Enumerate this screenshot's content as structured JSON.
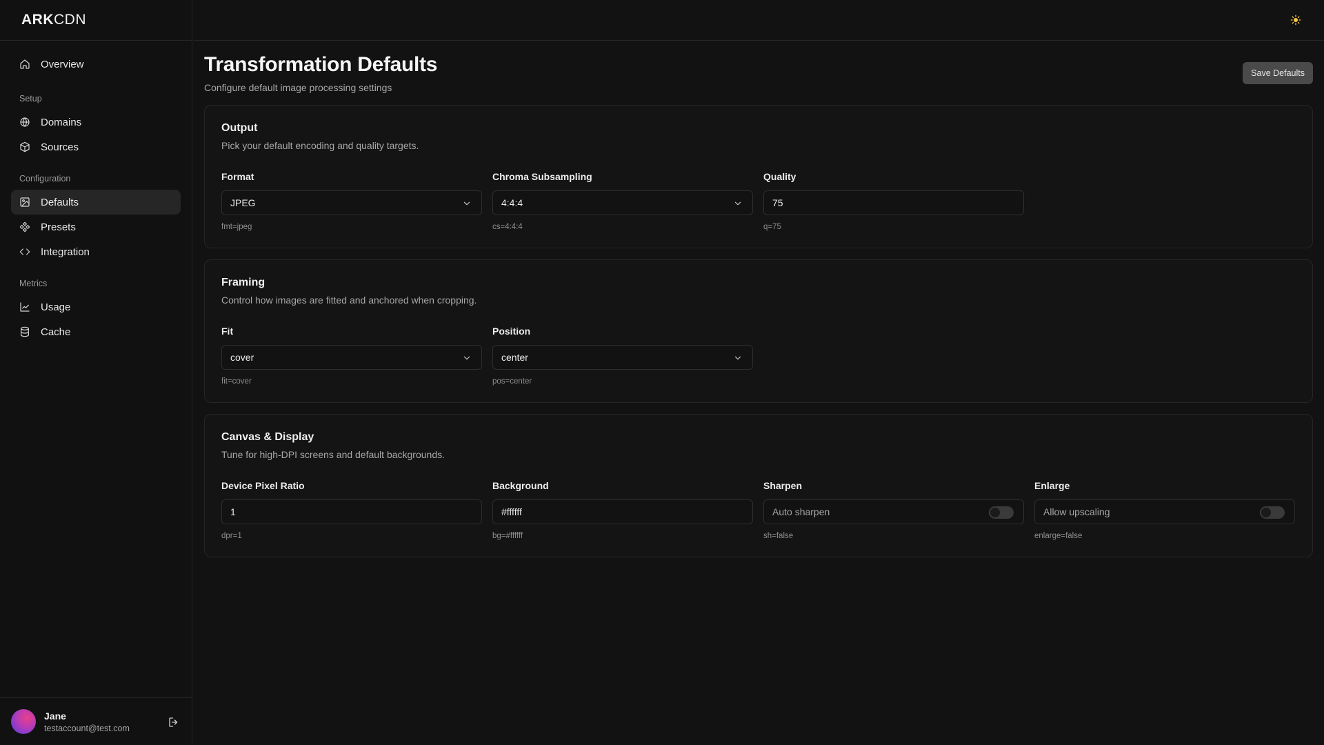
{
  "brand": {
    "strong": "ARK",
    "light": "CDN"
  },
  "nav": {
    "overview": "Overview",
    "setup_section": "Setup",
    "domains": "Domains",
    "sources": "Sources",
    "configuration_section": "Configuration",
    "defaults": "Defaults",
    "presets": "Presets",
    "integration": "Integration",
    "metrics_section": "Metrics",
    "usage": "Usage",
    "cache": "Cache"
  },
  "user": {
    "name": "Jane",
    "email": "testaccount@test.com"
  },
  "page": {
    "title": "Transformation Defaults",
    "subtitle": "Configure default image processing settings",
    "save_label": "Save Defaults"
  },
  "output": {
    "title": "Output",
    "description": "Pick your default encoding and quality targets.",
    "format": {
      "label": "Format",
      "value": "JPEG",
      "hint": "fmt=jpeg"
    },
    "chroma": {
      "label": "Chroma Subsampling",
      "value": "4:4:4",
      "hint": "cs=4:4:4"
    },
    "quality": {
      "label": "Quality",
      "value": "75",
      "hint": "q=75"
    }
  },
  "framing": {
    "title": "Framing",
    "description": "Control how images are fitted and anchored when cropping.",
    "fit": {
      "label": "Fit",
      "value": "cover",
      "hint": "fit=cover"
    },
    "position": {
      "label": "Position",
      "value": "center",
      "hint": "pos=center"
    }
  },
  "canvas": {
    "title": "Canvas & Display",
    "description": "Tune for high-DPI screens and default backgrounds.",
    "dpr": {
      "label": "Device Pixel Ratio",
      "value": "1",
      "hint": "dpr=1"
    },
    "background": {
      "label": "Background",
      "value": "#ffffff",
      "hint": "bg=#ffffff"
    },
    "sharpen": {
      "label": "Sharpen",
      "value": "Auto sharpen",
      "checked": false,
      "hint": "sh=false"
    },
    "enlarge": {
      "label": "Enlarge",
      "value": "Allow upscaling",
      "checked": false,
      "hint": "enlarge=false"
    }
  },
  "colors": {
    "background": "#121212",
    "sidebar": "#111111",
    "active_nav": "#262626",
    "save_button": "#4a4a4a",
    "sun_icon": "#f5c542"
  },
  "icons": [
    "home-icon",
    "globe-icon",
    "box-icon",
    "image-icon",
    "presets-icon",
    "code-icon",
    "chart-icon",
    "database-icon",
    "logout-icon",
    "sun-icon",
    "chevron-down-icon"
  ]
}
